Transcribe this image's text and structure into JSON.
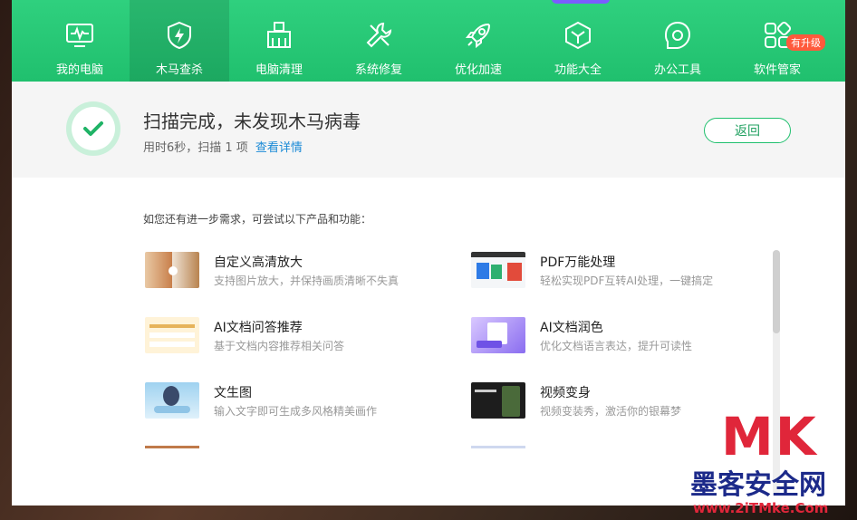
{
  "nav": {
    "items": [
      {
        "label": "我的电脑",
        "icon": "monitor-icon"
      },
      {
        "label": "木马查杀",
        "icon": "shield-icon"
      },
      {
        "label": "电脑清理",
        "icon": "broom-icon"
      },
      {
        "label": "系统修复",
        "icon": "wrench-icon"
      },
      {
        "label": "优化加速",
        "icon": "rocket-icon"
      },
      {
        "label": "功能大全",
        "icon": "cube-icon"
      },
      {
        "label": "办公工具",
        "icon": "office-icon"
      },
      {
        "label": "软件管家",
        "icon": "apps-icon"
      }
    ],
    "active_index": 1,
    "badge": "有升级"
  },
  "result": {
    "title": "扫描完成，未发现木马病毒",
    "sub": "用时6秒，扫描 1 项",
    "details_link": "查看详情",
    "back_label": "返回"
  },
  "suggestions": {
    "heading": "如您还有进一步需求，可尝试以下产品和功能：",
    "items": [
      {
        "title": "自定义高清放大",
        "desc": "支持图片放大，并保持画质清晰不失真"
      },
      {
        "title": "PDF万能处理",
        "desc": "轻松实现PDF互转AI处理，一键搞定"
      },
      {
        "title": "AI文档问答推荐",
        "desc": "基于文档内容推荐相关问答"
      },
      {
        "title": "AI文档润色",
        "desc": "优化文档语言表达，提升可读性"
      },
      {
        "title": "文生图",
        "desc": "输入文字即可生成多风格精美画作"
      },
      {
        "title": "视频变身",
        "desc": "视频变装秀，激活你的银幕梦"
      }
    ]
  },
  "watermark": {
    "mk": "MK",
    "cn": "墨客安全网",
    "url": "www.2iTMke.Com"
  },
  "colors": {
    "brand_green": "#20c06e",
    "link_blue": "#1a8ad6",
    "watermark_red": "#e0263a",
    "watermark_blue": "#1c2a8a"
  }
}
